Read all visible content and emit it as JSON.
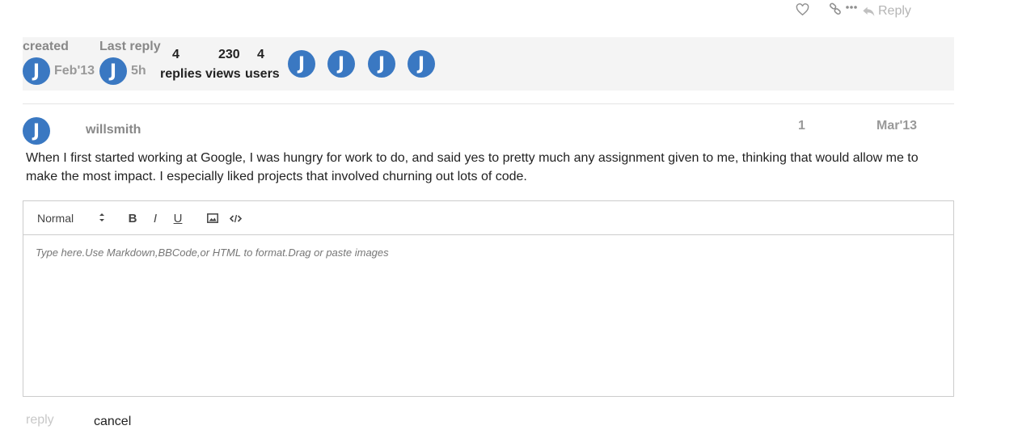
{
  "top_actions": {
    "like_icon": "heart-icon",
    "link_icon": "link-icon",
    "more_icon": "more-icon",
    "reply_label": "Reply",
    "muted_color": "#b5b5b5"
  },
  "topic_map": {
    "created_label": "created",
    "created_avatar": "J",
    "created_date": "Feb'13",
    "last_reply_label": "Last reply",
    "last_reply_avatar": "J",
    "last_reply_time": "5h",
    "replies_count": "4",
    "replies_label": "replies",
    "views_count": "230",
    "views_label": "views",
    "users_count": "4",
    "users_label": "users",
    "participants": [
      "J",
      "J",
      "J",
      "J"
    ],
    "avatar_color": "#3a78c2",
    "background": "#f4f4f4"
  },
  "post": {
    "avatar": "J",
    "username": "willsmith",
    "post_number": "1",
    "date": "Mar'13",
    "body_line1": "When I first started working at Google, I was hungry for work to do, and said yes to pretty much any assignment given to me, thinking that would allow me to",
    "body_line2": "make the most impact. I especially liked projects that involved churning out lots of code."
  },
  "editor": {
    "format_selected": "Normal",
    "toolbar_icons": [
      "bold-icon",
      "italic-icon",
      "underline-icon",
      "image-icon",
      "code-icon"
    ],
    "bold_label": "B",
    "italic_label": "I",
    "underline_label": "U",
    "placeholder": "Type here.Use Markdown,BBCode,or HTML to format.Drag or paste images"
  },
  "actions": {
    "reply_label": "reply",
    "cancel_label": "cancel"
  }
}
